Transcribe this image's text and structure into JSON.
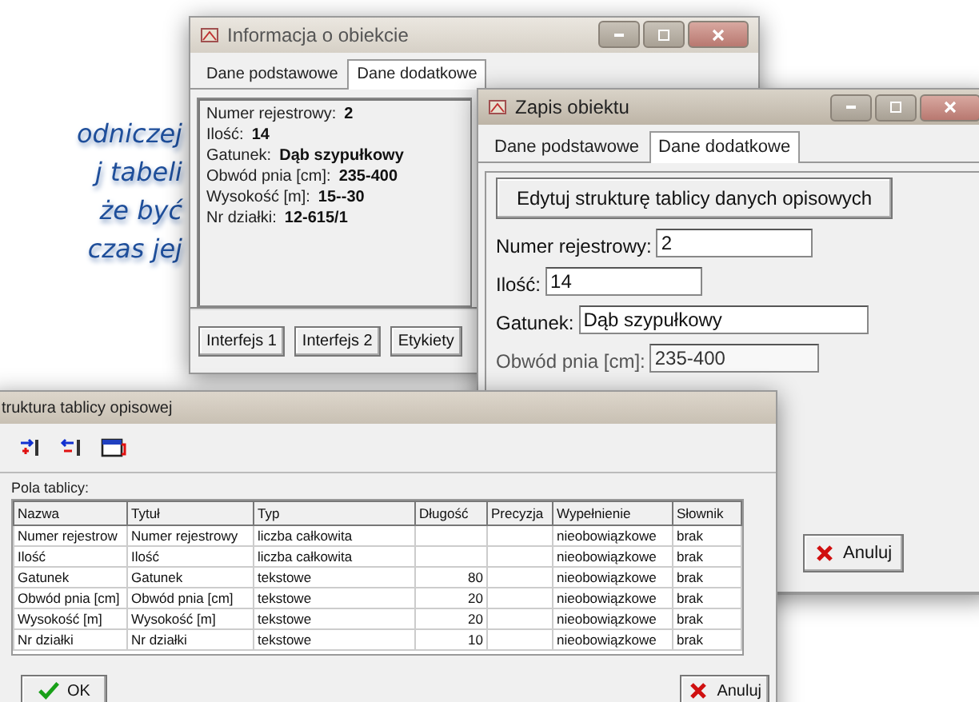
{
  "intro_text": {
    "lines": [
      "odniczej",
      "j tabeli",
      "że być",
      "czas jej"
    ]
  },
  "info_window": {
    "title": "Informacja o obiekcie",
    "tabs": [
      {
        "label": "Dane podstawowe",
        "selected": false
      },
      {
        "label": "Dane dodatkowe",
        "selected": true
      }
    ],
    "fields": [
      {
        "label": "Numer rejestrowy:",
        "value": "2"
      },
      {
        "label": "Ilość:",
        "value": "14"
      },
      {
        "label": "Gatunek:",
        "value": "Dąb szypułkowy"
      },
      {
        "label": "Obwód pnia [cm]:",
        "value": "235-400"
      },
      {
        "label": "Wysokość [m]:",
        "value": "15--30"
      },
      {
        "label": "Nr działki:",
        "value": "12-615/1"
      }
    ],
    "buttons": [
      "Interfejs 1",
      "Interfejs 2",
      "Etykiety"
    ]
  },
  "edit_window": {
    "title": "Zapis obiektu",
    "tabs": [
      {
        "label": "Dane podstawowe",
        "selected": false
      },
      {
        "label": "Dane dodatkowe",
        "selected": true
      }
    ],
    "edit_button": "Edytuj strukturę tablicy danych opisowych",
    "fields": [
      {
        "label": "Numer rejestrowy:",
        "value": "2"
      },
      {
        "label": "Ilość:",
        "value": "14"
      },
      {
        "label": "Gatunek:",
        "value": "Dąb szypułkowy"
      },
      {
        "label": "Obwód pnia [cm]:",
        "value": "235-400"
      }
    ],
    "cancel_button": "Anuluj"
  },
  "structure_window": {
    "title": "truktura tablicy opisowej",
    "fields_label": "Pola tablicy:",
    "table": {
      "columns": [
        "Nazwa",
        "Tytuł",
        "Typ",
        "Długość",
        "Precyzja",
        "Wypełnienie",
        "Słownik"
      ],
      "rows": [
        [
          "Numer rejestrow",
          "Numer rejestrowy",
          "liczba całkowita",
          "",
          "",
          "nieobowiązkowe",
          "brak"
        ],
        [
          "Ilość",
          "Ilość",
          "liczba całkowita",
          "",
          "",
          "nieobowiązkowe",
          "brak"
        ],
        [
          "Gatunek",
          "Gatunek",
          "tekstowe",
          "80",
          "",
          "nieobowiązkowe",
          "brak"
        ],
        [
          "Obwód pnia [cm]",
          "Obwód pnia [cm]",
          "tekstowe",
          "20",
          "",
          "nieobowiązkowe",
          "brak"
        ],
        [
          "Wysokość [m]",
          "Wysokość [m]",
          "tekstowe",
          "20",
          "",
          "nieobowiązkowe",
          "brak"
        ],
        [
          "Nr działki",
          "Nr działki",
          "tekstowe",
          "10",
          "",
          "nieobowiązkowe",
          "brak"
        ]
      ]
    },
    "ok_button": "OK",
    "cancel_button": "Anuluj"
  }
}
